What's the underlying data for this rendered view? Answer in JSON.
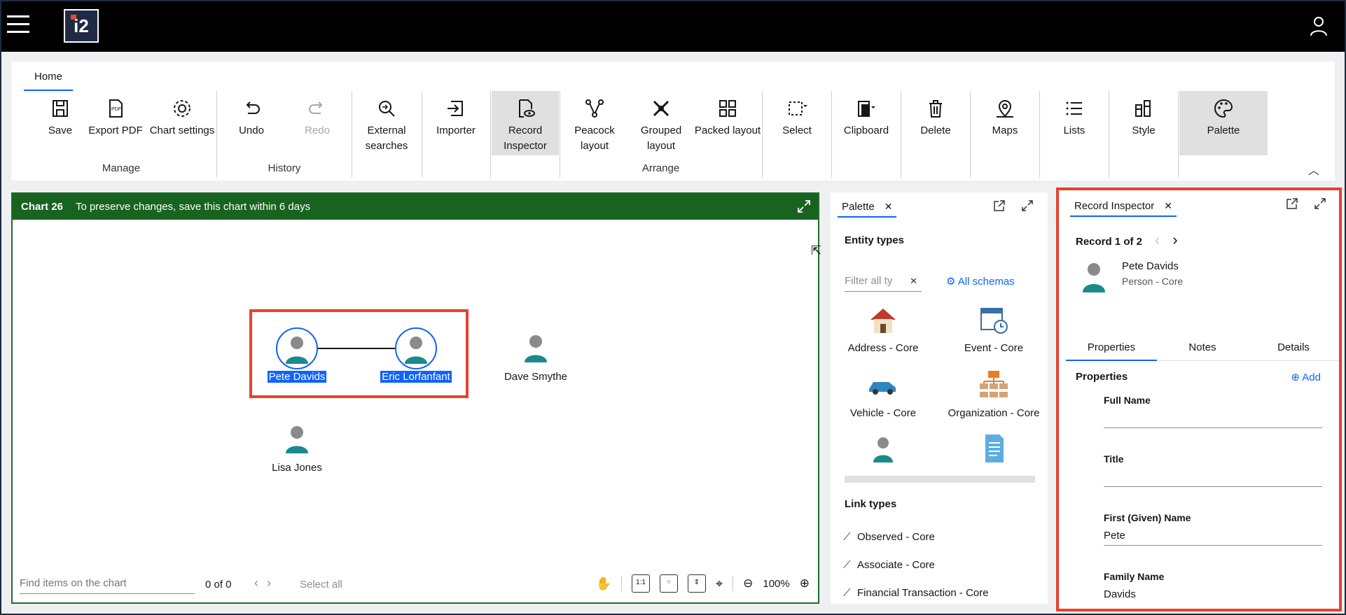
{
  "app": {
    "logo_text": "i2"
  },
  "ribbon": {
    "tab": "Home",
    "tools": {
      "save": "Save",
      "export_pdf": "Export PDF",
      "chart_settings": "Chart settings",
      "undo": "Undo",
      "redo": "Redo",
      "external_searches": "External searches",
      "importer": "Importer",
      "record_inspector": "Record Inspector",
      "peacock_layout": "Peacock layout",
      "grouped_layout": "Grouped layout",
      "packed_layout": "Packed layout",
      "select": "Select",
      "clipboard": "Clipboard",
      "delete": "Delete",
      "maps": "Maps",
      "lists": "Lists",
      "style": "Style",
      "palette": "Palette"
    },
    "groups": {
      "manage": "Manage",
      "history": "History",
      "arrange": "Arrange"
    }
  },
  "chart": {
    "title": "Chart 26",
    "message": "To preserve changes, save this chart within 6 days",
    "nodes": {
      "pete": "Pete Davids",
      "eric": "Eric Lorfanfant",
      "dave": "Dave Smythe",
      "lisa": "Lisa Jones"
    },
    "footer": {
      "find_placeholder": "Find items on the chart",
      "count": "0 of 0",
      "select_all": "Select all",
      "zoom": "100%"
    }
  },
  "palette": {
    "tab": "Palette",
    "entity_types_heading": "Entity types",
    "filter_placeholder": "Filter all ty",
    "all_schemas": "All schemas",
    "entities": {
      "address": "Address - Core",
      "event": "Event - Core",
      "vehicle": "Vehicle - Core",
      "organization": "Organization - Core"
    },
    "link_types_heading": "Link types",
    "links": {
      "observed": "Observed - Core",
      "associate": "Associate - Core",
      "financial": "Financial Transaction - Core"
    }
  },
  "inspector": {
    "tab": "Record Inspector",
    "record_nav": "Record 1 of 2",
    "name": "Pete Davids",
    "type": "Person - Core",
    "tabs": {
      "properties": "Properties",
      "notes": "Notes",
      "details": "Details"
    },
    "properties_heading": "Properties",
    "add": "Add",
    "fields": {
      "full_name_label": "Full Name",
      "full_name_value": "",
      "title_label": "Title",
      "title_value": "",
      "first_name_label": "First (Given) Name",
      "first_name_value": "Pete",
      "family_name_label": "Family Name",
      "family_name_value": "Davids"
    }
  },
  "colors": {
    "topbar": "#000000",
    "chart_header": "#18631f",
    "accent": "#0f62fe",
    "highlight_border": "#e8412c"
  }
}
